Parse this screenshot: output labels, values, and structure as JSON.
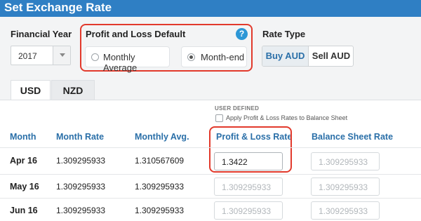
{
  "header": {
    "title": "Set Exchange Rate"
  },
  "financial_year": {
    "label": "Financial Year",
    "value": "2017"
  },
  "pl_default": {
    "label": "Profit and Loss Default",
    "help": "?",
    "options": [
      {
        "label": "Monthly Average",
        "selected": false
      },
      {
        "label": "Month-end",
        "selected": true
      }
    ]
  },
  "rate_type": {
    "label": "Rate Type",
    "options": [
      "Buy AUD",
      "Sell AUD"
    ],
    "selected": "Buy AUD"
  },
  "tabs": [
    "USD",
    "NZD"
  ],
  "active_tab": "USD",
  "user_defined": {
    "label": "USER DEFINED",
    "checkbox_label": "Apply Profit & Loss Rates to Balance Sheet",
    "checked": false
  },
  "table": {
    "headers": [
      "Month",
      "Month Rate",
      "Monthly Avg.",
      "Profit & Loss Rate",
      "Balance Sheet Rate"
    ],
    "rows": [
      {
        "month": "Apr 16",
        "month_rate": "1.309295933",
        "monthly_avg": "1.310567609",
        "pl_rate": "1.3422",
        "bs_rate": "1.309295933"
      },
      {
        "month": "May 16",
        "month_rate": "1.309295933",
        "monthly_avg": "1.309295933",
        "pl_rate": "1.309295933",
        "bs_rate": "1.309295933"
      },
      {
        "month": "Jun 16",
        "month_rate": "1.309295933",
        "monthly_avg": "1.309295933",
        "pl_rate": "1.309295933",
        "bs_rate": "1.309295933"
      }
    ]
  },
  "colors": {
    "header_bg": "#2f7fc4",
    "accent_text": "#2a6fa8",
    "highlight_border": "#e23a2c",
    "help_icon": "#2d97d6"
  }
}
